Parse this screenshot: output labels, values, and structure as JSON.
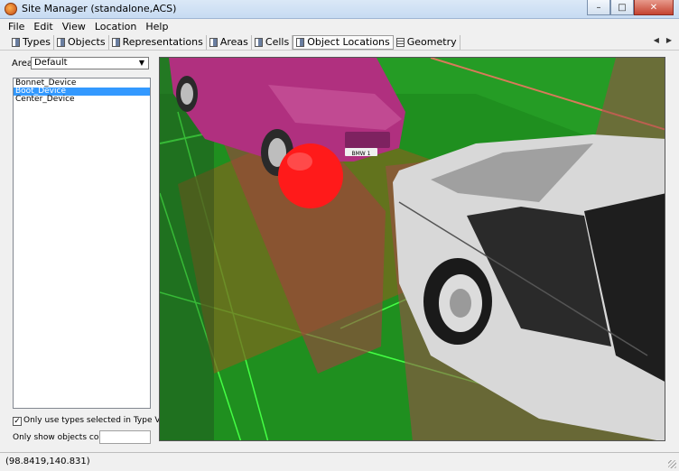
{
  "window": {
    "title": "Site Manager (standalone,ACS)"
  },
  "menubar": {
    "items": [
      "File",
      "Edit",
      "View",
      "Location",
      "Help"
    ]
  },
  "toolbar": {
    "tabs": [
      "Types",
      "Objects",
      "Representations",
      "Areas",
      "Cells",
      "Object Locations",
      "Geometry"
    ],
    "active": "Object Locations"
  },
  "area": {
    "label": "Area:",
    "selected": "Default"
  },
  "objects": {
    "items": [
      "Bonnet_Device",
      "Boot_Device",
      "Center_Device"
    ],
    "selected": "Boot_Device"
  },
  "filters": {
    "only_use_types_label": "Only use types selected in Type View",
    "only_use_types_checked": true,
    "only_show_label": "Only show objects containing:",
    "only_show_value": ""
  },
  "status": {
    "coords": "(98.8419,140.831)"
  },
  "scene": {
    "car_front_label": "BMW 1",
    "colors": {
      "ground": "#1f8f1f",
      "magenta_car": "#b0307f",
      "sphere": "#ff1a1a",
      "white_car": "#d8d8d8",
      "zone": "#9a3a3a"
    }
  }
}
